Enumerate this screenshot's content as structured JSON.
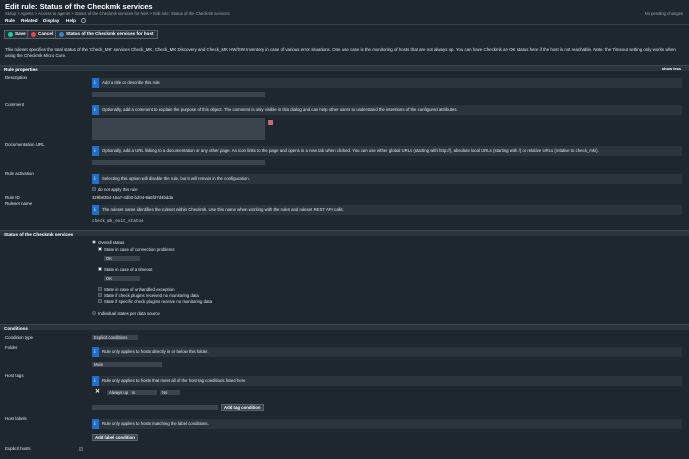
{
  "header": {
    "title": "Edit rule: Status of the Checkmk services",
    "breadcrumb": "Setup > Agents > Access to agents > Status of the Checkmk services for host > Edit rule: Status of the Checkmk services",
    "pending": "No pending changes"
  },
  "menu": [
    "Rule",
    "Related",
    "Display",
    "Help"
  ],
  "toolbar": {
    "save": "Save",
    "cancel": "Cancel",
    "host_btn": "Status of the Checkmk services for host"
  },
  "intro": "This ruleset specifies the total status of the 'Check_MK' services Check_MK, Check_MK Discovery and Check_MK HW/SW Inventory in case of various error situations. One use case is the monitoring of hosts that are not always up. You can have Checkmk an OK status here if the host is not reachable. Note: the Timeout setting only works when using the Checkmk Micro Core.",
  "sections": {
    "rule_properties": "Rule properties",
    "status": "Status of the Checkmk services",
    "conditions": "Conditions"
  },
  "show_less": "show less",
  "fields": {
    "description": {
      "label": "Description",
      "help": "Add a title or describe this rule"
    },
    "comment": {
      "label": "Comment",
      "help": "Optionally, add a comment to explain the purpose of this object. The comment is only visible in this dialog and can help other users to understand the intentions of the configured attributes."
    },
    "doc_url": {
      "label": "Documentation URL",
      "help": "Optionally, add a URL linking to a documentation or any other page. An icon links to the page and opens in a new tab when clicked. You can use either global URLs (starting with http://), absolute local URLs (starting with /) or relative URLs (relative to check_mk/)."
    },
    "activation": {
      "label": "Rule activation",
      "help": "Selecting this option will disable the rule, but it will remain in the configuration.",
      "checkbox": "do not apply this rule"
    },
    "rule_id": {
      "label": "Rule ID",
      "value": "329b8354-15a7-4db0-b204-9a6f37d4bdda"
    },
    "ruleset_name": {
      "label": "Ruleset name",
      "help": "The ruleset name identifies the ruleset within Checkmk. Use this name when working with the rules and ruleset REST API calls.",
      "value": "check_mk_exit_status"
    }
  },
  "status": {
    "overall": "Overall status",
    "conn_problems": "State in case of connection problems",
    "conn_value": "OK",
    "timeout": "State in case of a timeout",
    "timeout_value": "OK",
    "unhandled": "State in case of unhandled exception",
    "no_plugins": "State if check plugins received no monitoring data",
    "specific_plugins": "State if specific check plugins receive no monitoring data",
    "individual": "Individual states per data source"
  },
  "conditions": {
    "type_label": "Condition type",
    "type_value": "Explicit conditions",
    "folder_label": "Folder",
    "folder_help": "Rule only applies to hosts directly in or below this folder.",
    "folder_value": "Main",
    "tags_label": "Host tags",
    "tags_help": "Rule only applies to hosts that meet all of the host tag conditions listed here",
    "tag_name": "Always up",
    "tag_op": "is",
    "tag_value": "No",
    "add_tag": "Add tag condition",
    "labels_label": "Host labels",
    "labels_help": "Rule only applies to hosts matching the label conditions.",
    "add_label": "Add label condition",
    "explicit_hosts": "Explicit hosts"
  }
}
